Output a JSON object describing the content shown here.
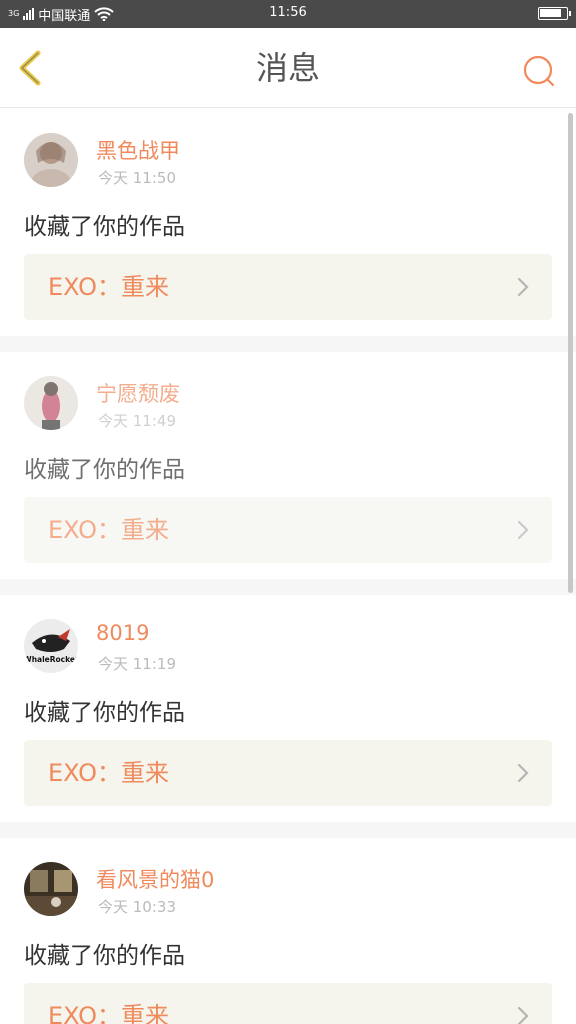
{
  "status_bar": {
    "carrier_badge": "3G",
    "carrier": "中国联通",
    "time": "11:56"
  },
  "header": {
    "title": "消息",
    "back_icon": "chevron-left-icon",
    "search_icon": "search-icon"
  },
  "messages": [
    {
      "username": "黑色战甲",
      "time": "今天 11:50",
      "action": "收藏了你的作品",
      "work_title": "EXO：重来"
    },
    {
      "username": "宁愿颓废",
      "time": "今天 11:49",
      "action": "收藏了你的作品",
      "work_title": "EXO：重来"
    },
    {
      "username": "8019",
      "time": "今天 11:19",
      "action": "收藏了你的作品",
      "work_title": "EXO：重来",
      "avatar_text": "WhaleRocket"
    },
    {
      "username": "看风景的猫0",
      "time": "今天 10:33",
      "action": "收藏了你的作品",
      "work_title": "EXO：重来"
    }
  ],
  "colors": {
    "accent": "#f08a5d",
    "back_icon": "#e8c94a",
    "status_bar": "#4a4a4a",
    "work_bg": "#f5f5ee"
  }
}
